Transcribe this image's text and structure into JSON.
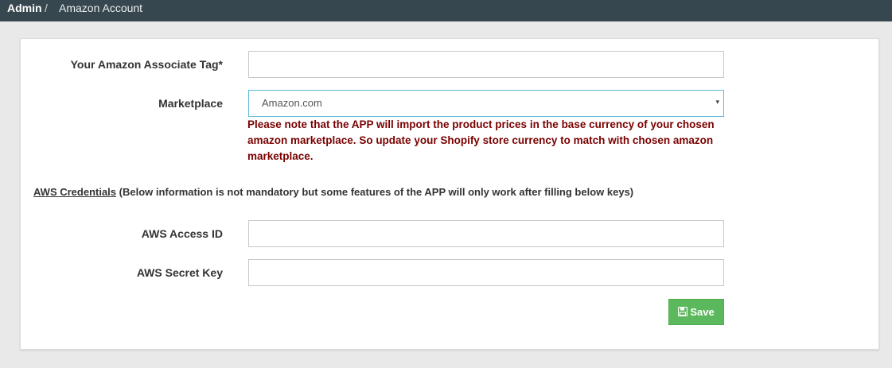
{
  "breadcrumb": {
    "root": "Admin",
    "separator": "/",
    "current": "Amazon Account"
  },
  "form": {
    "associate_tag": {
      "label": "Your Amazon Associate Tag*",
      "value": ""
    },
    "marketplace": {
      "label": "Marketplace",
      "selected": "Amazon.com",
      "caret": "▾",
      "note": "Please note that the APP will import the product prices in the base currency of your chosen amazon marketplace. So update your Shopify store currency to match with chosen amazon marketplace."
    },
    "aws_section": {
      "title": "AWS Credentials",
      "description": " (Below information is not mandatory but some features of the APP will only work after filling below keys)"
    },
    "aws_access_id": {
      "label": "AWS Access ID",
      "value": ""
    },
    "aws_secret_key": {
      "label": "AWS Secret Key",
      "value": ""
    },
    "save_button": {
      "label": "Save",
      "icon": "floppy-disk-icon"
    }
  },
  "colors": {
    "topbar": "#37474f",
    "note_text": "#7a0000",
    "save_button": "#5cb85c",
    "select_border": "#5bbad5"
  }
}
